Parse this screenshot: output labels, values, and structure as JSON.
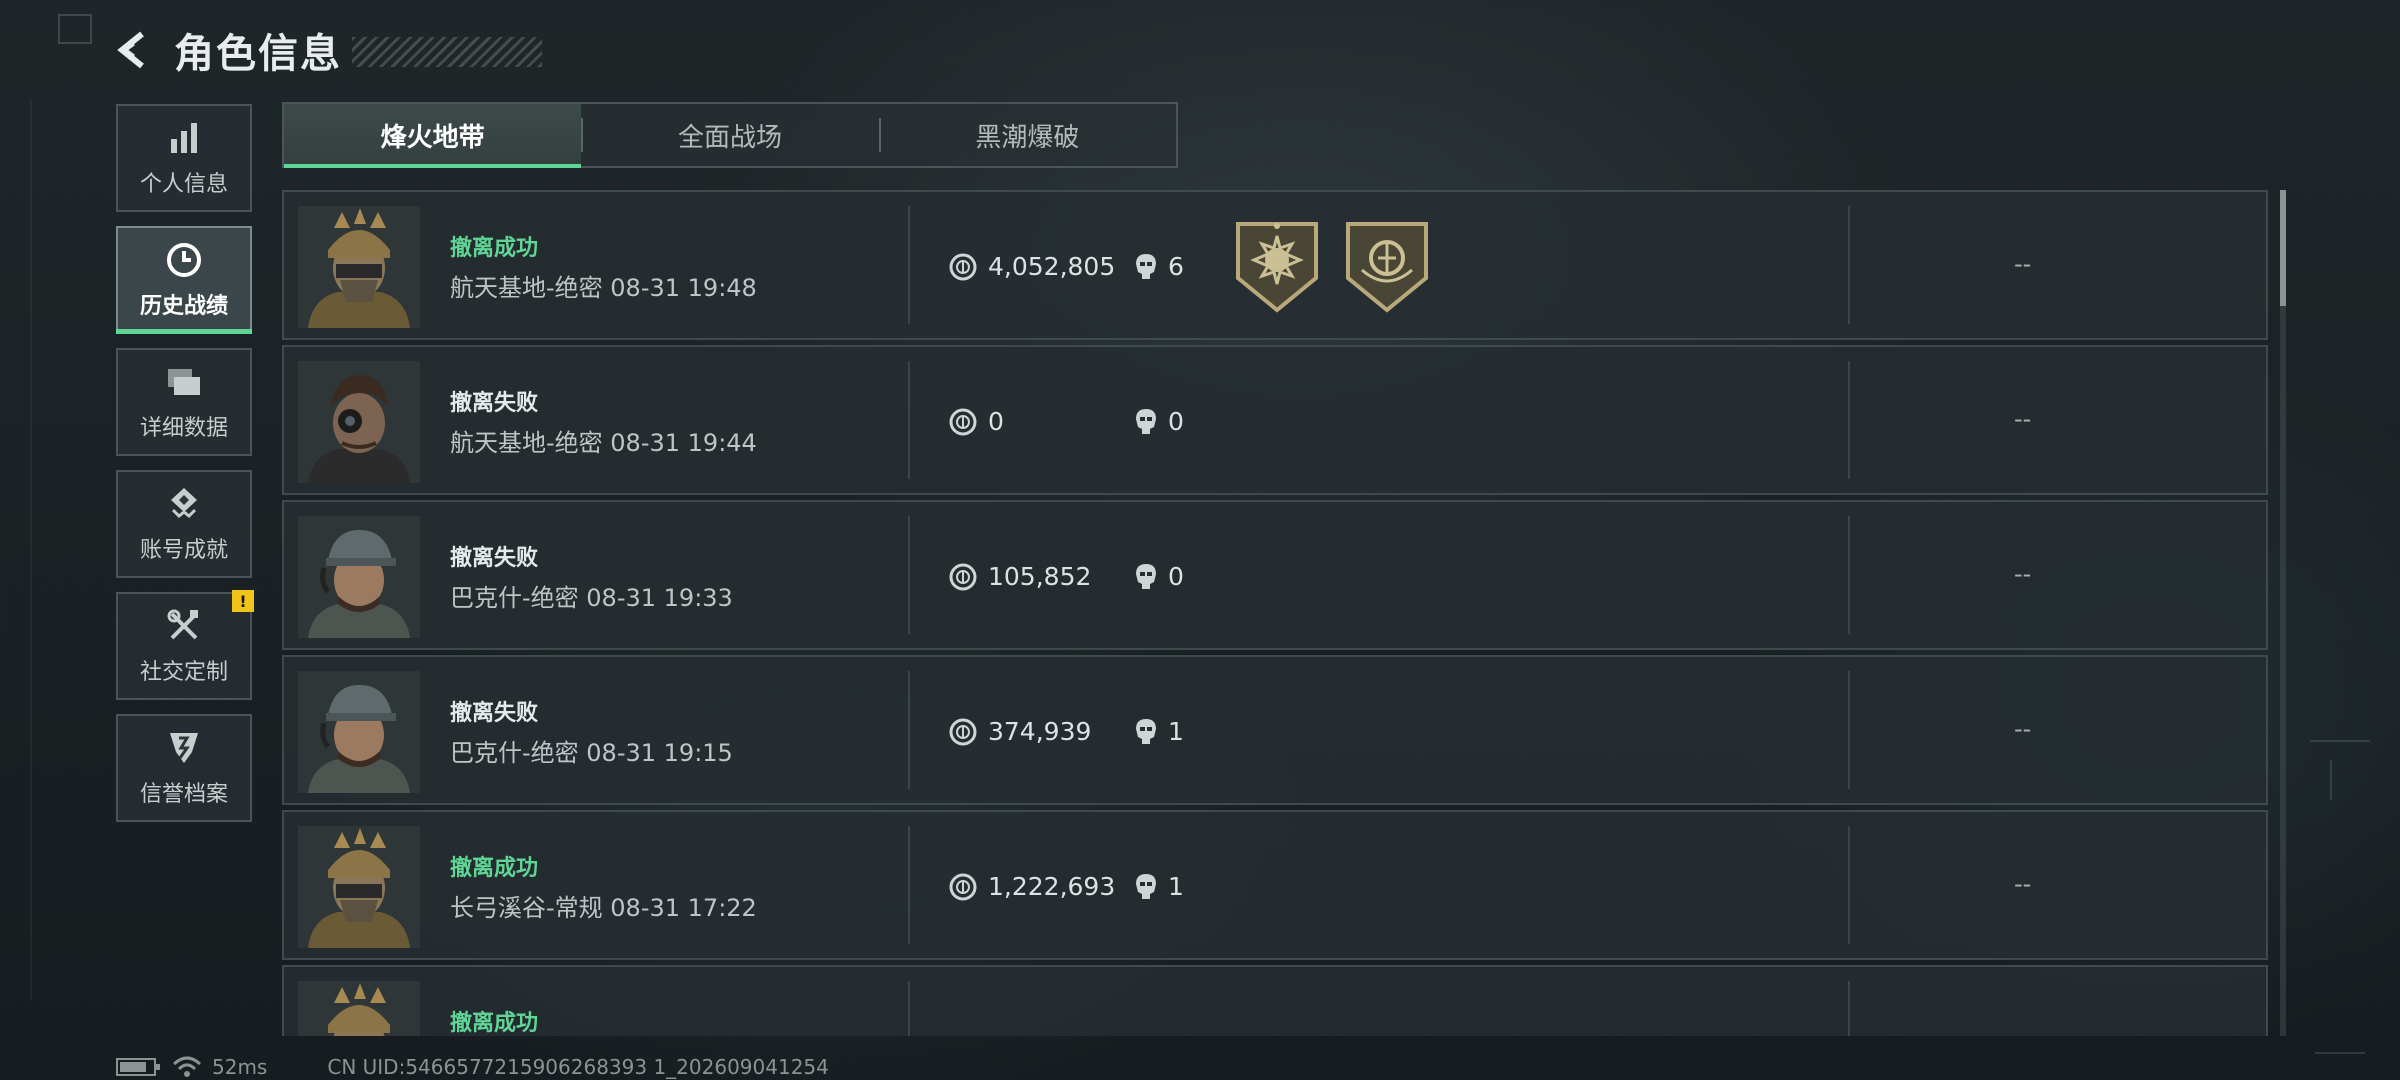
{
  "header": {
    "title": "角色信息"
  },
  "sidebar": {
    "items": [
      {
        "label": "个人信息",
        "icon": "bar-chart-icon",
        "active": false
      },
      {
        "label": "历史战绩",
        "icon": "clock-icon",
        "active": true
      },
      {
        "label": "详细数据",
        "icon": "folders-icon",
        "active": false
      },
      {
        "label": "账号成就",
        "icon": "achievement-icon",
        "active": false
      },
      {
        "label": "社交定制",
        "icon": "tools-icon",
        "active": false,
        "alert": "!"
      },
      {
        "label": "信誉档案",
        "icon": "shield-emblem-icon",
        "active": false
      }
    ]
  },
  "tabs": [
    {
      "label": "烽火地带",
      "active": true
    },
    {
      "label": "全面战场",
      "active": false
    },
    {
      "label": "黑潮爆破",
      "active": false
    }
  ],
  "matches": [
    {
      "result": "撤离成功",
      "status": "success",
      "meta": "航天基地-绝密 08-31 19:48",
      "coins": "4,052,805",
      "kills": "6",
      "badges": [
        "sun-badge-icon",
        "emblem-badge-icon"
      ],
      "extra": "--"
    },
    {
      "result": "撤离失败",
      "status": "fail",
      "meta": "航天基地-绝密 08-31 19:44",
      "coins": "0",
      "kills": "0",
      "badges": [],
      "extra": "--"
    },
    {
      "result": "撤离失败",
      "status": "fail",
      "meta": "巴克什-绝密 08-31 19:33",
      "coins": "105,852",
      "kills": "0",
      "badges": [],
      "extra": "--"
    },
    {
      "result": "撤离失败",
      "status": "fail",
      "meta": "巴克什-绝密 08-31 19:15",
      "coins": "374,939",
      "kills": "1",
      "badges": [],
      "extra": "--"
    },
    {
      "result": "撤离成功",
      "status": "success",
      "meta": "长弓溪谷-常规 08-31 17:22",
      "coins": "1,222,693",
      "kills": "1",
      "badges": [],
      "extra": "--"
    },
    {
      "result": "撤离成功",
      "status": "success",
      "meta": "",
      "coins": "",
      "kills": "",
      "badges": [],
      "extra": "--"
    }
  ],
  "footer": {
    "ping": "52ms",
    "uid": "CN UID:5466577215906268393 1_202609041254"
  },
  "colors": {
    "accent": "#5fd596",
    "alert": "#f0c419"
  }
}
